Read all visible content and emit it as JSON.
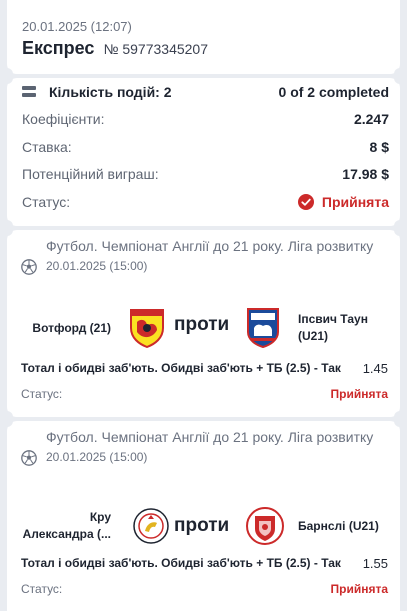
{
  "header": {
    "datetime": "20.01.2025 (12:07)",
    "title": "Експрес",
    "number": "№ 59773345207"
  },
  "summary": {
    "events_label": "Кількість подій: 2",
    "events_progress": "0 of 2 completed",
    "odds_label": "Коефіцієнти:",
    "odds_value": "2.247",
    "stake_label": "Ставка:",
    "stake_value": "8 $",
    "potential_label": "Потенційний виграш:",
    "potential_value": "17.98 $",
    "status_label": "Статус:",
    "status_value": "Прийнята",
    "status_color": "#cc2a2a"
  },
  "events": [
    {
      "league": "Футбол. Чемпіонат Англії до 21 року. Ліга розвитку",
      "date": "20.01.2025 (15:00)",
      "home": "Вотфорд (21)",
      "vs": "проти",
      "away": "Іпсвич Таун (U21)",
      "market": "Тотал і обидві заб'ють. Обидві заб'ють + ТБ (2.5) - Так",
      "odd": "1.45",
      "status_label": "Статус:",
      "status_value": "Прийнята",
      "home_icon": "watford-crest-icon",
      "away_icon": "ipswich-crest-icon"
    },
    {
      "league": "Футбол. Чемпіонат Англії до 21 року. Ліга розвитку",
      "date": "20.01.2025 (15:00)",
      "home": "Кру Александра (...",
      "vs": "проти",
      "away": "Барнслі (U21)",
      "market": "Тотал і обидві заб'ють. Обидві заб'ють + ТБ (2.5) - Так",
      "odd": "1.55",
      "status_label": "Статус:",
      "status_value": "Прийнята",
      "home_icon": "crewe-crest-icon",
      "away_icon": "barnsley-crest-icon"
    }
  ]
}
